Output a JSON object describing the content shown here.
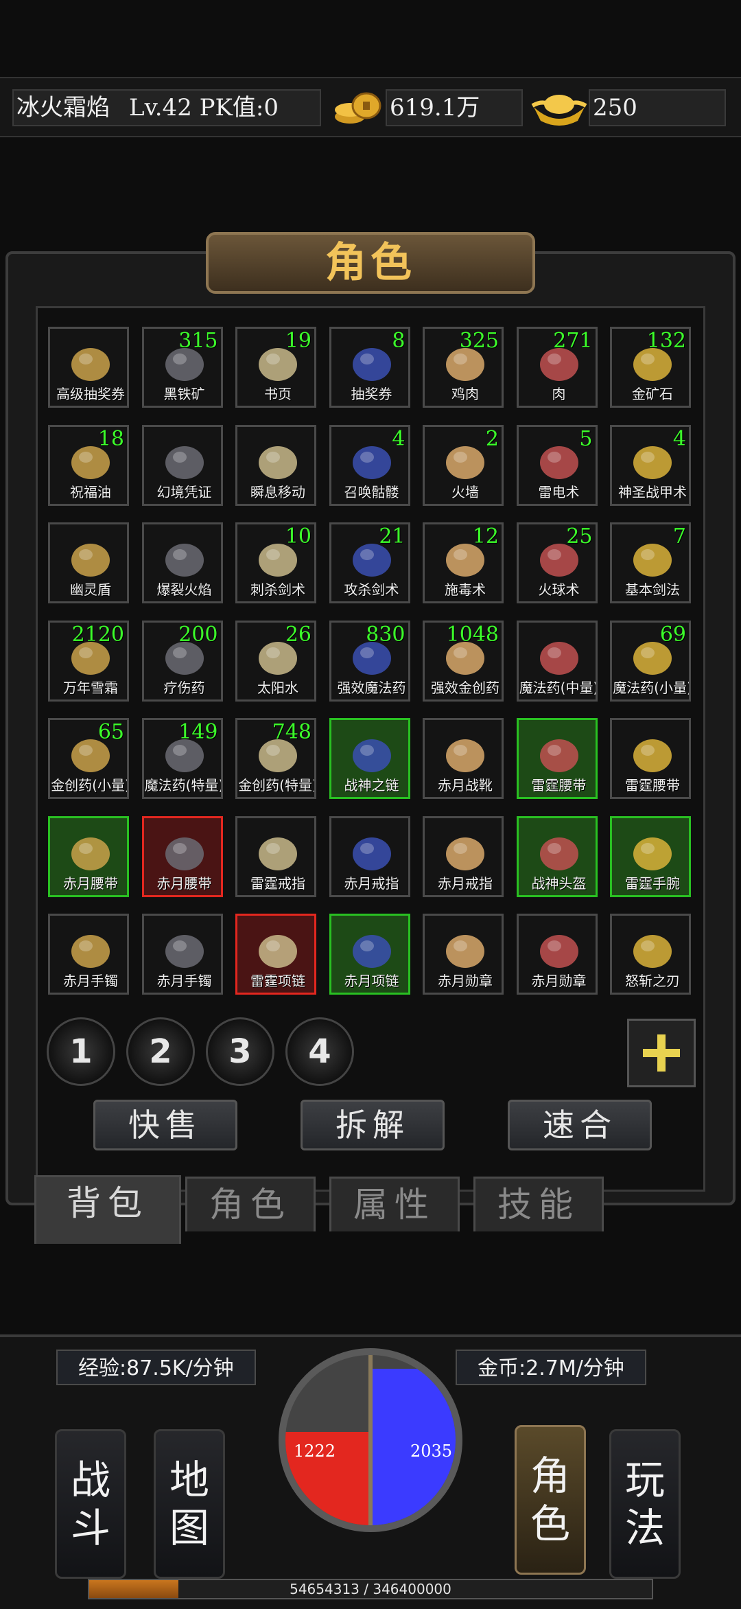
{
  "header": {
    "player": "冰火霜焰",
    "level_info": "Lv.42 PK值:0",
    "gold": "619.1万",
    "ingots": "250"
  },
  "panel": {
    "title": "角色"
  },
  "inventory": [
    {
      "name": "高级抽奖券",
      "count": ""
    },
    {
      "name": "黑铁矿",
      "count": "315"
    },
    {
      "name": "书页",
      "count": "19"
    },
    {
      "name": "抽奖券",
      "count": "8"
    },
    {
      "name": "鸡肉",
      "count": "325"
    },
    {
      "name": "肉",
      "count": "271"
    },
    {
      "name": "金矿石",
      "count": "132"
    },
    {
      "name": "祝福油",
      "count": "18"
    },
    {
      "name": "幻境凭证",
      "count": ""
    },
    {
      "name": "瞬息移动",
      "count": ""
    },
    {
      "name": "召唤骷髅",
      "count": "4"
    },
    {
      "name": "火墙",
      "count": "2"
    },
    {
      "name": "雷电术",
      "count": "5"
    },
    {
      "name": "神圣战甲术",
      "count": "4"
    },
    {
      "name": "幽灵盾",
      "count": ""
    },
    {
      "name": "爆裂火焰",
      "count": ""
    },
    {
      "name": "刺杀剑术",
      "count": "10"
    },
    {
      "name": "攻杀剑术",
      "count": "21"
    },
    {
      "name": "施毒术",
      "count": "12"
    },
    {
      "name": "火球术",
      "count": "25"
    },
    {
      "name": "基本剑法",
      "count": "7"
    },
    {
      "name": "万年雪霜",
      "count": "2120"
    },
    {
      "name": "疗伤药",
      "count": "200"
    },
    {
      "name": "太阳水",
      "count": "26"
    },
    {
      "name": "强效魔法药",
      "count": "830"
    },
    {
      "name": "强效金创药",
      "count": "1048"
    },
    {
      "name": "魔法药(中量)",
      "count": ""
    },
    {
      "name": "魔法药(小量)",
      "count": "69"
    },
    {
      "name": "金创药(小量)",
      "count": "65"
    },
    {
      "name": "魔法药(特量)",
      "count": "149"
    },
    {
      "name": "金创药(特量)",
      "count": "748"
    },
    {
      "name": "战神之链",
      "count": "",
      "border": "green"
    },
    {
      "name": "赤月战靴",
      "count": ""
    },
    {
      "name": "雷霆腰带",
      "count": "",
      "border": "green"
    },
    {
      "name": "雷霆腰带",
      "count": ""
    },
    {
      "name": "赤月腰带",
      "count": "",
      "border": "green"
    },
    {
      "name": "赤月腰带",
      "count": "",
      "border": "red"
    },
    {
      "name": "雷霆戒指",
      "count": ""
    },
    {
      "name": "赤月戒指",
      "count": ""
    },
    {
      "name": "赤月戒指",
      "count": ""
    },
    {
      "name": "战神头盔",
      "count": "",
      "border": "green"
    },
    {
      "name": "雷霆手腕",
      "count": "",
      "border": "green"
    },
    {
      "name": "赤月手镯",
      "count": ""
    },
    {
      "name": "赤月手镯",
      "count": ""
    },
    {
      "name": "雷霆项链",
      "count": "",
      "border": "red"
    },
    {
      "name": "赤月项链",
      "count": "",
      "border": "green"
    },
    {
      "name": "赤月勋章",
      "count": ""
    },
    {
      "name": "赤月勋章",
      "count": ""
    },
    {
      "name": "怒斩之刃",
      "count": ""
    }
  ],
  "pages": [
    "1",
    "2",
    "3",
    "4"
  ],
  "actions": {
    "quick_sell": "快售",
    "dismantle": "拆解",
    "merge": "速合"
  },
  "tabs": [
    "背包",
    "角色",
    "属性",
    "技能"
  ],
  "hud": {
    "exp_rate": "经验:87.5K/分钟",
    "gold_rate": "金币:2.7M/分钟",
    "hp": "1222",
    "mp": "2035",
    "hp_fraction": 0.55,
    "mp_fraction": 0.92,
    "xp_text": "54654313 / 346400000",
    "xp_fraction": 0.158
  },
  "nav": {
    "fight": "战斗",
    "map": "地图",
    "role": "角色",
    "play": "玩法"
  },
  "colors": {
    "count_green": "#3cff2a",
    "title_gold": "#f2c35a",
    "hp_red": "#e3271f",
    "mp_blue": "#3b3bff"
  }
}
